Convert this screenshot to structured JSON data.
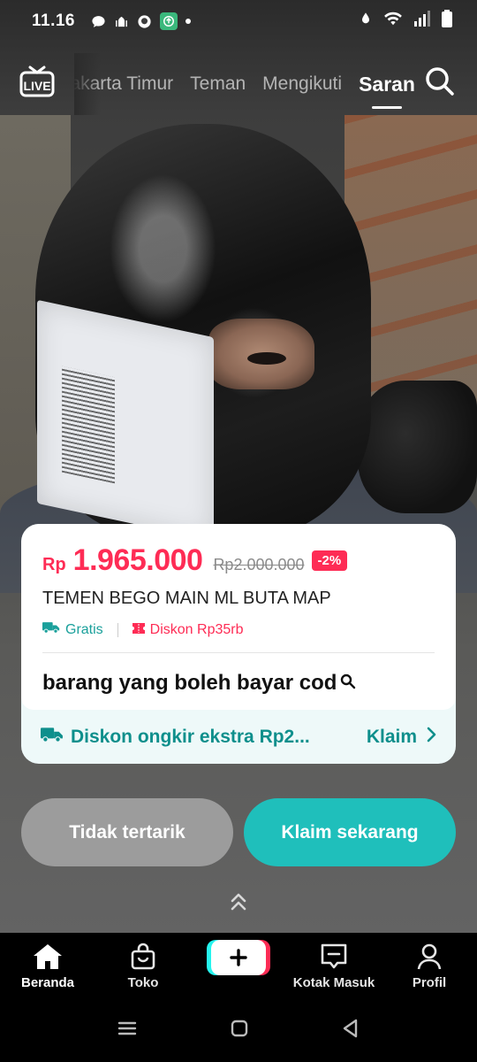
{
  "status_bar": {
    "time": "11.16"
  },
  "top_nav": {
    "live_label": "LIVE",
    "tabs": [
      {
        "label": "Jakarta Timur"
      },
      {
        "label": "Teman"
      },
      {
        "label": "Mengikuti"
      },
      {
        "label": "Saran"
      }
    ],
    "active_tab": "Saran"
  },
  "product": {
    "currency": "Rp",
    "price": "1.965.000",
    "original_price": "Rp2.000.000",
    "discount_badge": "-2%",
    "title": "TEMEN BEGO MAIN ML BUTA MAP",
    "tag_shipping": "Gratis",
    "tag_discount": "Diskon Rp35rb",
    "search_query": "barang yang boleh bayar cod",
    "promo_text": "Diskon ongkir ekstra Rp2...",
    "promo_action": "Klaim"
  },
  "actions": {
    "decline_label": "Tidak tertarik",
    "accept_label": "Klaim sekarang"
  },
  "tab_bar": {
    "items": [
      {
        "label": "Beranda",
        "icon": "home-icon"
      },
      {
        "label": "Toko",
        "icon": "shop-bag-icon"
      },
      {
        "label": "",
        "icon": "create-plus-icon"
      },
      {
        "label": "Kotak Masuk",
        "icon": "inbox-icon"
      },
      {
        "label": "Profil",
        "icon": "profile-icon"
      }
    ],
    "active": "Beranda"
  },
  "colors": {
    "accent_red": "#fe2c55",
    "accent_teal": "#1fbfbb",
    "teal_text": "#0e8f8c"
  }
}
